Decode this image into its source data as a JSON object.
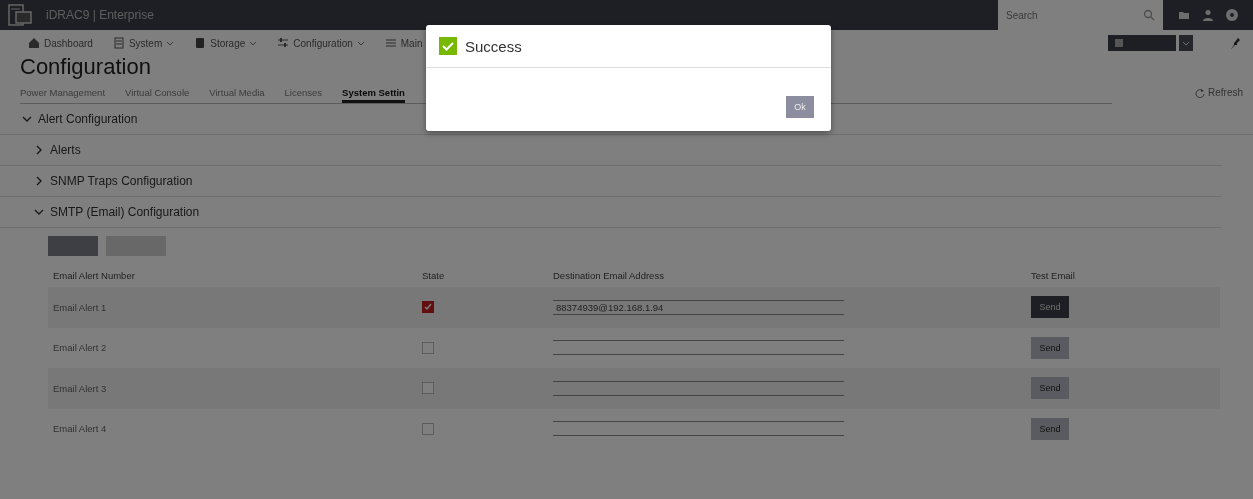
{
  "header": {
    "title": "iDRAC9 | Enterprise",
    "search": {
      "placeholder": "Search"
    }
  },
  "nav": [
    {
      "label": "Dashboard",
      "dropdown": false
    },
    {
      "label": "System",
      "dropdown": true
    },
    {
      "label": "Storage",
      "dropdown": true
    },
    {
      "label": "Configuration",
      "dropdown": true
    },
    {
      "label": "Main",
      "dropdown": false
    }
  ],
  "page_title": "Configuration",
  "tabs": [
    {
      "label": "Power Management",
      "selected": false
    },
    {
      "label": "Virtual Console",
      "selected": false
    },
    {
      "label": "Virtual Media",
      "selected": false
    },
    {
      "label": "Licenses",
      "selected": false
    },
    {
      "label": "System Settin",
      "selected": true
    }
  ],
  "refresh": "Refresh",
  "sections": [
    {
      "title": "Alert Configuration",
      "expanded": true,
      "children": [
        {
          "title": "Alerts",
          "expanded": false
        },
        {
          "title": "SNMP Traps Configuration",
          "expanded": false
        },
        {
          "title": "SMTP (Email) Configuration",
          "expanded": true
        }
      ]
    }
  ],
  "table": {
    "columns": [
      "Email Alert Number",
      "State",
      "Destination Email Address",
      "Test Email"
    ],
    "rows": [
      {
        "name": "Email Alert 1",
        "checked": true,
        "email": "88374939@192.168.1.94",
        "send": "Send",
        "send_disabled": false
      },
      {
        "name": "Email Alert 2",
        "checked": false,
        "send": "Send",
        "send_disabled": true
      },
      {
        "name": "Email Alert 3",
        "checked": false,
        "send": "Send",
        "send_disabled": true
      },
      {
        "name": "Email Alert 4",
        "checked": false,
        "send": "Send",
        "send_disabled": true
      }
    ]
  },
  "modal": {
    "title": "Success",
    "button": "Ok"
  }
}
